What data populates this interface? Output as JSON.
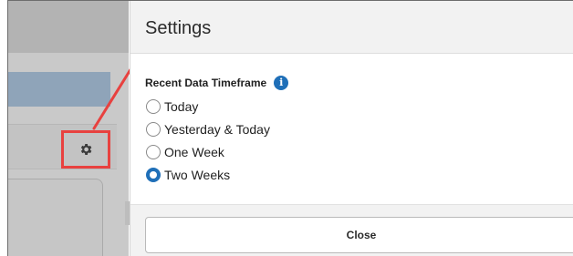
{
  "settings": {
    "title": "Settings",
    "section_label": "Recent Data Timeframe",
    "info_icon_glyph": "i",
    "options": [
      {
        "label": "Today",
        "selected": false
      },
      {
        "label": "Yesterday & Today",
        "selected": false
      },
      {
        "label": "One Week",
        "selected": false
      },
      {
        "label": "Two Weeks",
        "selected": true
      }
    ],
    "close_label": "Close"
  },
  "icons": {
    "gear": "gear-icon",
    "info": "info-icon"
  },
  "colors": {
    "accent": "#1f6fb8",
    "callout": "#e8413f"
  }
}
